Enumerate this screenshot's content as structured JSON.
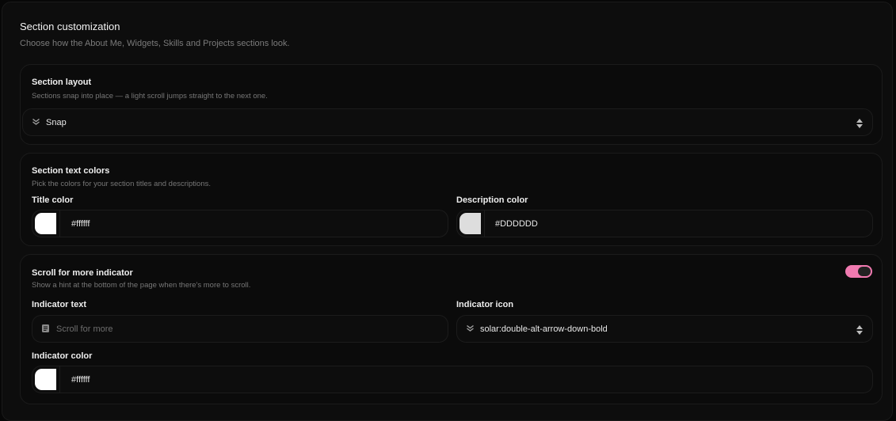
{
  "header": {
    "title": "Section customization",
    "description": "Choose how the About Me, Widgets, Skills and Projects sections look."
  },
  "section_layout": {
    "title": "Section layout",
    "description": "Sections snap into place — a light scroll jumps straight to the next one.",
    "select": {
      "value": "Snap",
      "icon": "chevron-double-down-icon"
    }
  },
  "section_text_colors": {
    "title": "Section text colors",
    "description": "Pick the colors for your section titles and descriptions.",
    "title_color": {
      "label": "Title color",
      "value": "#ffffff",
      "swatch": "#ffffff"
    },
    "description_color": {
      "label": "Description color",
      "value": "#DDDDDD",
      "swatch": "#DDDDDD"
    }
  },
  "scroll_indicator": {
    "title": "Scroll for more indicator",
    "description": "Show a hint at the bottom of the page when there's more to scroll.",
    "enabled": true,
    "toggle_color": "#f07ab0",
    "indicator_text": {
      "label": "Indicator text",
      "placeholder": "Scroll for more",
      "value": ""
    },
    "indicator_icon": {
      "label": "Indicator icon",
      "value": "solar:double-alt-arrow-down-bold",
      "icon": "chevron-double-down-icon"
    },
    "indicator_color": {
      "label": "Indicator color",
      "value": "#ffffff",
      "swatch": "#ffffff"
    }
  }
}
